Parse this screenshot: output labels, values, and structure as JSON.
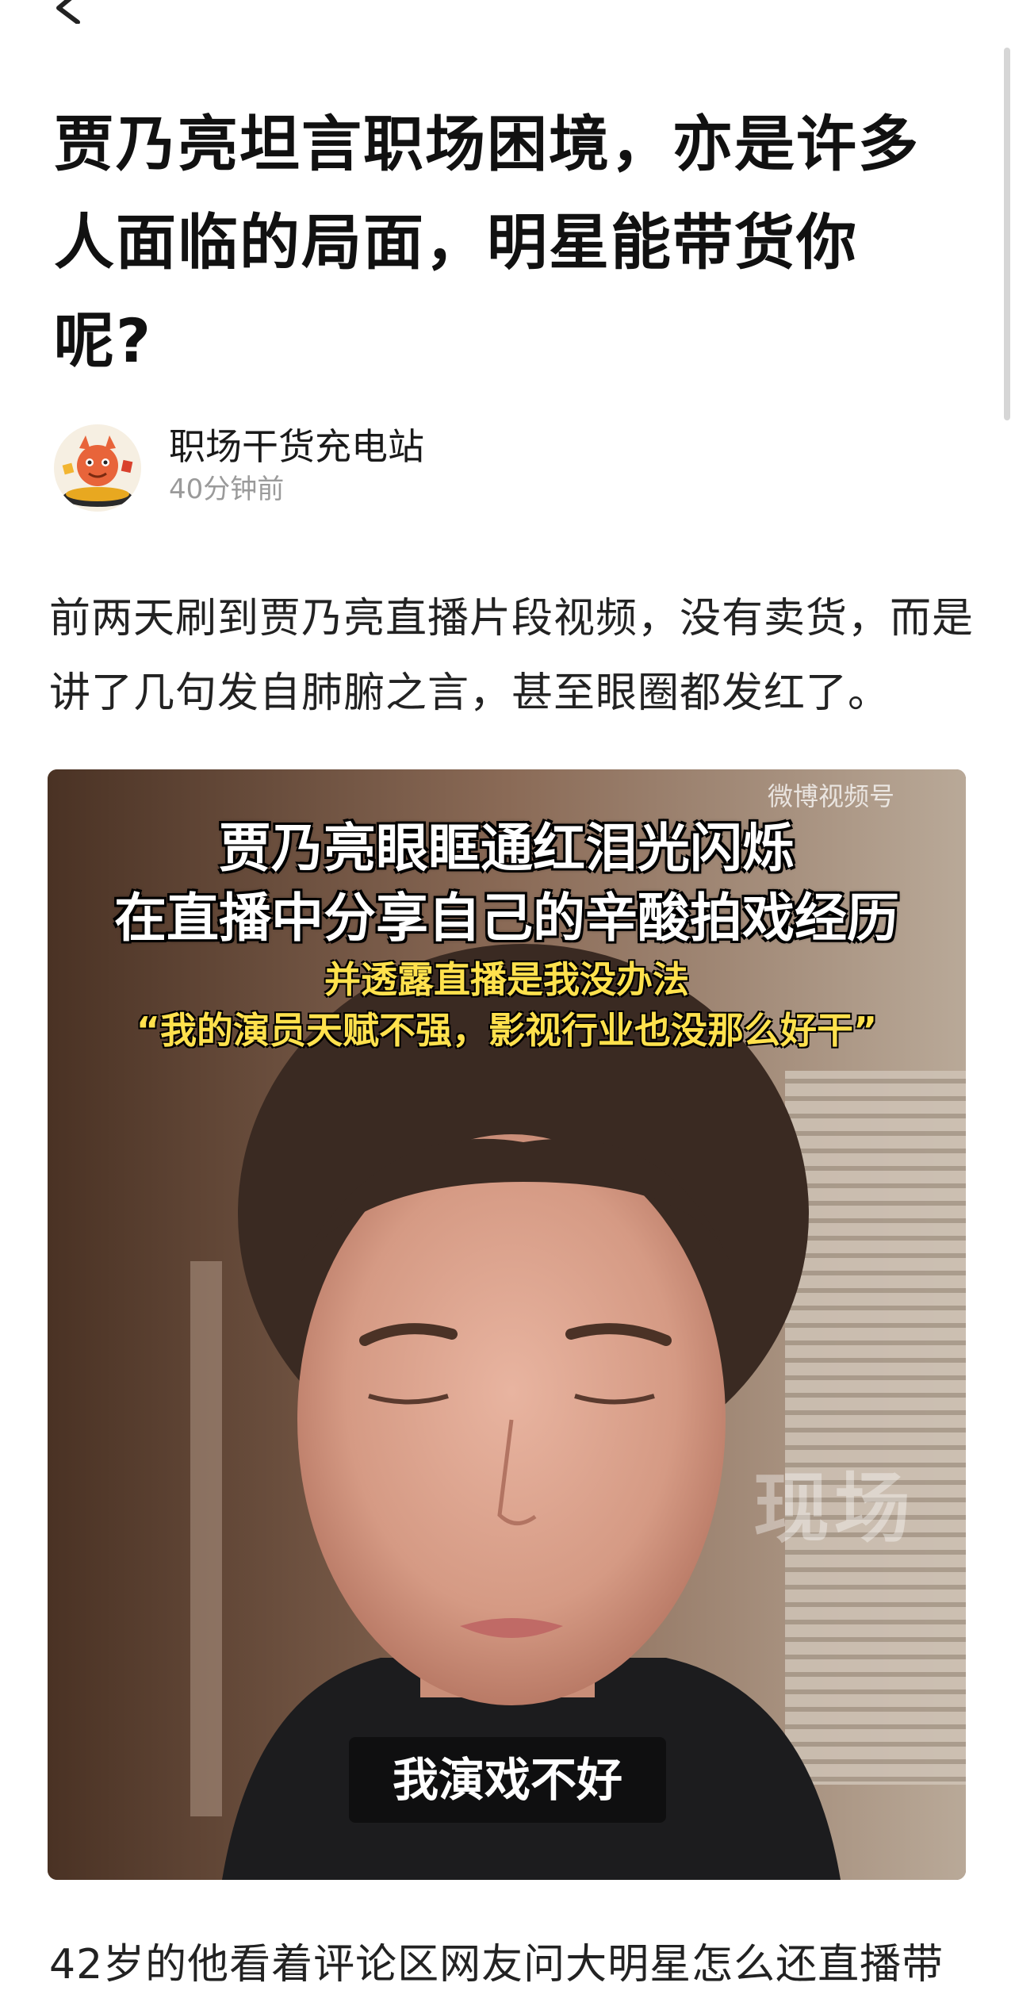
{
  "nav": {
    "back_icon": "chevron-left-icon"
  },
  "article": {
    "title": "贾乃亮坦言职场困境，亦是许多人面临的局面，明星能带货你呢?",
    "author": {
      "name": "职场干货充电站",
      "time": "40分钟前"
    },
    "paragraphs": [
      "前两天刷到贾乃亮直播片段视频，没有卖货，而是讲了几句发自肺腑之言，甚至眼圈都发红了。",
      "42岁的他看着评论区网友问大明星怎么还直播带"
    ],
    "video": {
      "watermark_top": "微博视频号",
      "captions": [
        "贾乃亮眼眶通红泪光闪烁",
        "在直播中分享自己的辛酸拍戏经历",
        "并透露直播是我没办法",
        "“我的演员天赋不强，影视行业也没那么好干”"
      ],
      "watermark_side": "现场",
      "subtitle": "我演戏不好"
    }
  },
  "colors": {
    "text_primary": "#111111",
    "text_secondary": "#9a9a9a",
    "caption_yellow": "#ffe14d",
    "background": "#ffffff"
  }
}
